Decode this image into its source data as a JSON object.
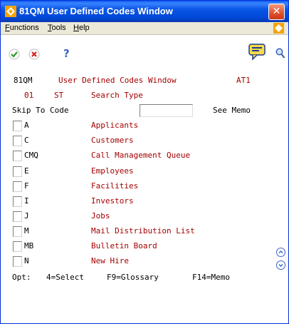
{
  "window": {
    "title": "81QM  User Defined Codes Window",
    "close_symbol": "✕"
  },
  "menu": {
    "items": [
      {
        "label_underlined": "F",
        "label_rest": "unctions"
      },
      {
        "label_underlined": "T",
        "label_rest": "ools"
      },
      {
        "label_underlined": "H",
        "label_rest": "elp"
      }
    ]
  },
  "toolbar": {
    "icons": [
      "check-icon",
      "cancel-icon",
      "help-icon",
      "memo-chat-icon",
      "search-icon"
    ],
    "help_symbol": "?"
  },
  "header": {
    "form_id": "81QM",
    "form_title": "User Defined Codes Window",
    "environment": "AT1",
    "product_code": "01",
    "code_type": "ST",
    "code_type_desc": "Search Type"
  },
  "skip": {
    "label": "Skip To Code",
    "value": "",
    "see_memo": "See Memo"
  },
  "rows": [
    {
      "code": "A",
      "description": "Applicants"
    },
    {
      "code": "C",
      "description": "Customers"
    },
    {
      "code": "CMQ",
      "description": "Call Management Queue"
    },
    {
      "code": "E",
      "description": "Employees"
    },
    {
      "code": "F",
      "description": "Facilities"
    },
    {
      "code": "I",
      "description": "Investors"
    },
    {
      "code": "J",
      "description": "Jobs"
    },
    {
      "code": "M",
      "description": "Mail Distribution List"
    },
    {
      "code": "MB",
      "description": "Bulletin Board"
    },
    {
      "code": "N",
      "description": "New Hire"
    }
  ],
  "footer": {
    "opt": "Opt:",
    "select": "4=Select",
    "glossary": "F9=Glossary",
    "memo": "F14=Memo"
  },
  "colors": {
    "title_blue": "#0a56e6",
    "label_red": "#a50000",
    "close_red": "#e0502a"
  }
}
